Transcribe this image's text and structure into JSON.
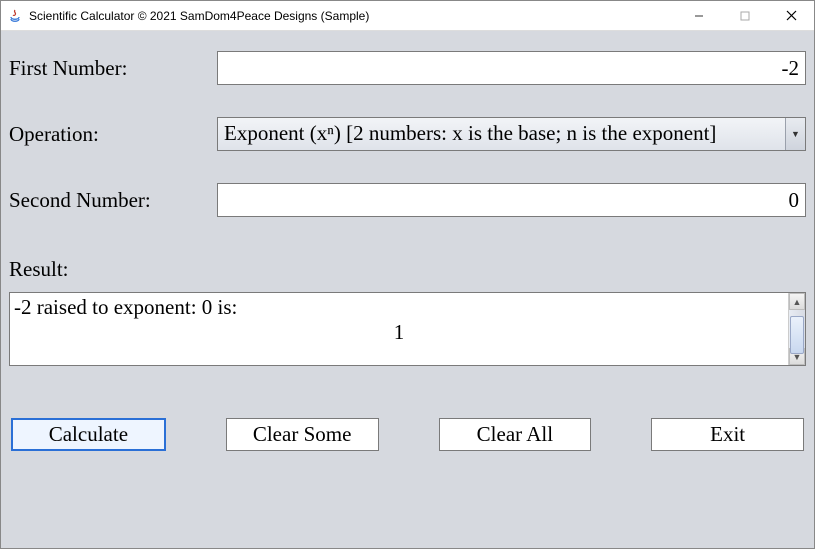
{
  "window": {
    "title": "Scientific Calculator © 2021 SamDom4Peace Designs (Sample)"
  },
  "labels": {
    "first_number": "First Number:",
    "operation": "Operation:",
    "second_number": "Second Number:",
    "result": "Result:"
  },
  "inputs": {
    "first_number": "-2",
    "second_number": "0",
    "operation_selected": "Exponent (xⁿ) [2 numbers: x is the base; n is the exponent]"
  },
  "result": {
    "line1": "-2 raised to exponent: 0 is:",
    "line2": "1"
  },
  "buttons": {
    "calculate": "Calculate",
    "clear_some": "Clear Some",
    "clear_all": "Clear All",
    "exit": "Exit"
  }
}
